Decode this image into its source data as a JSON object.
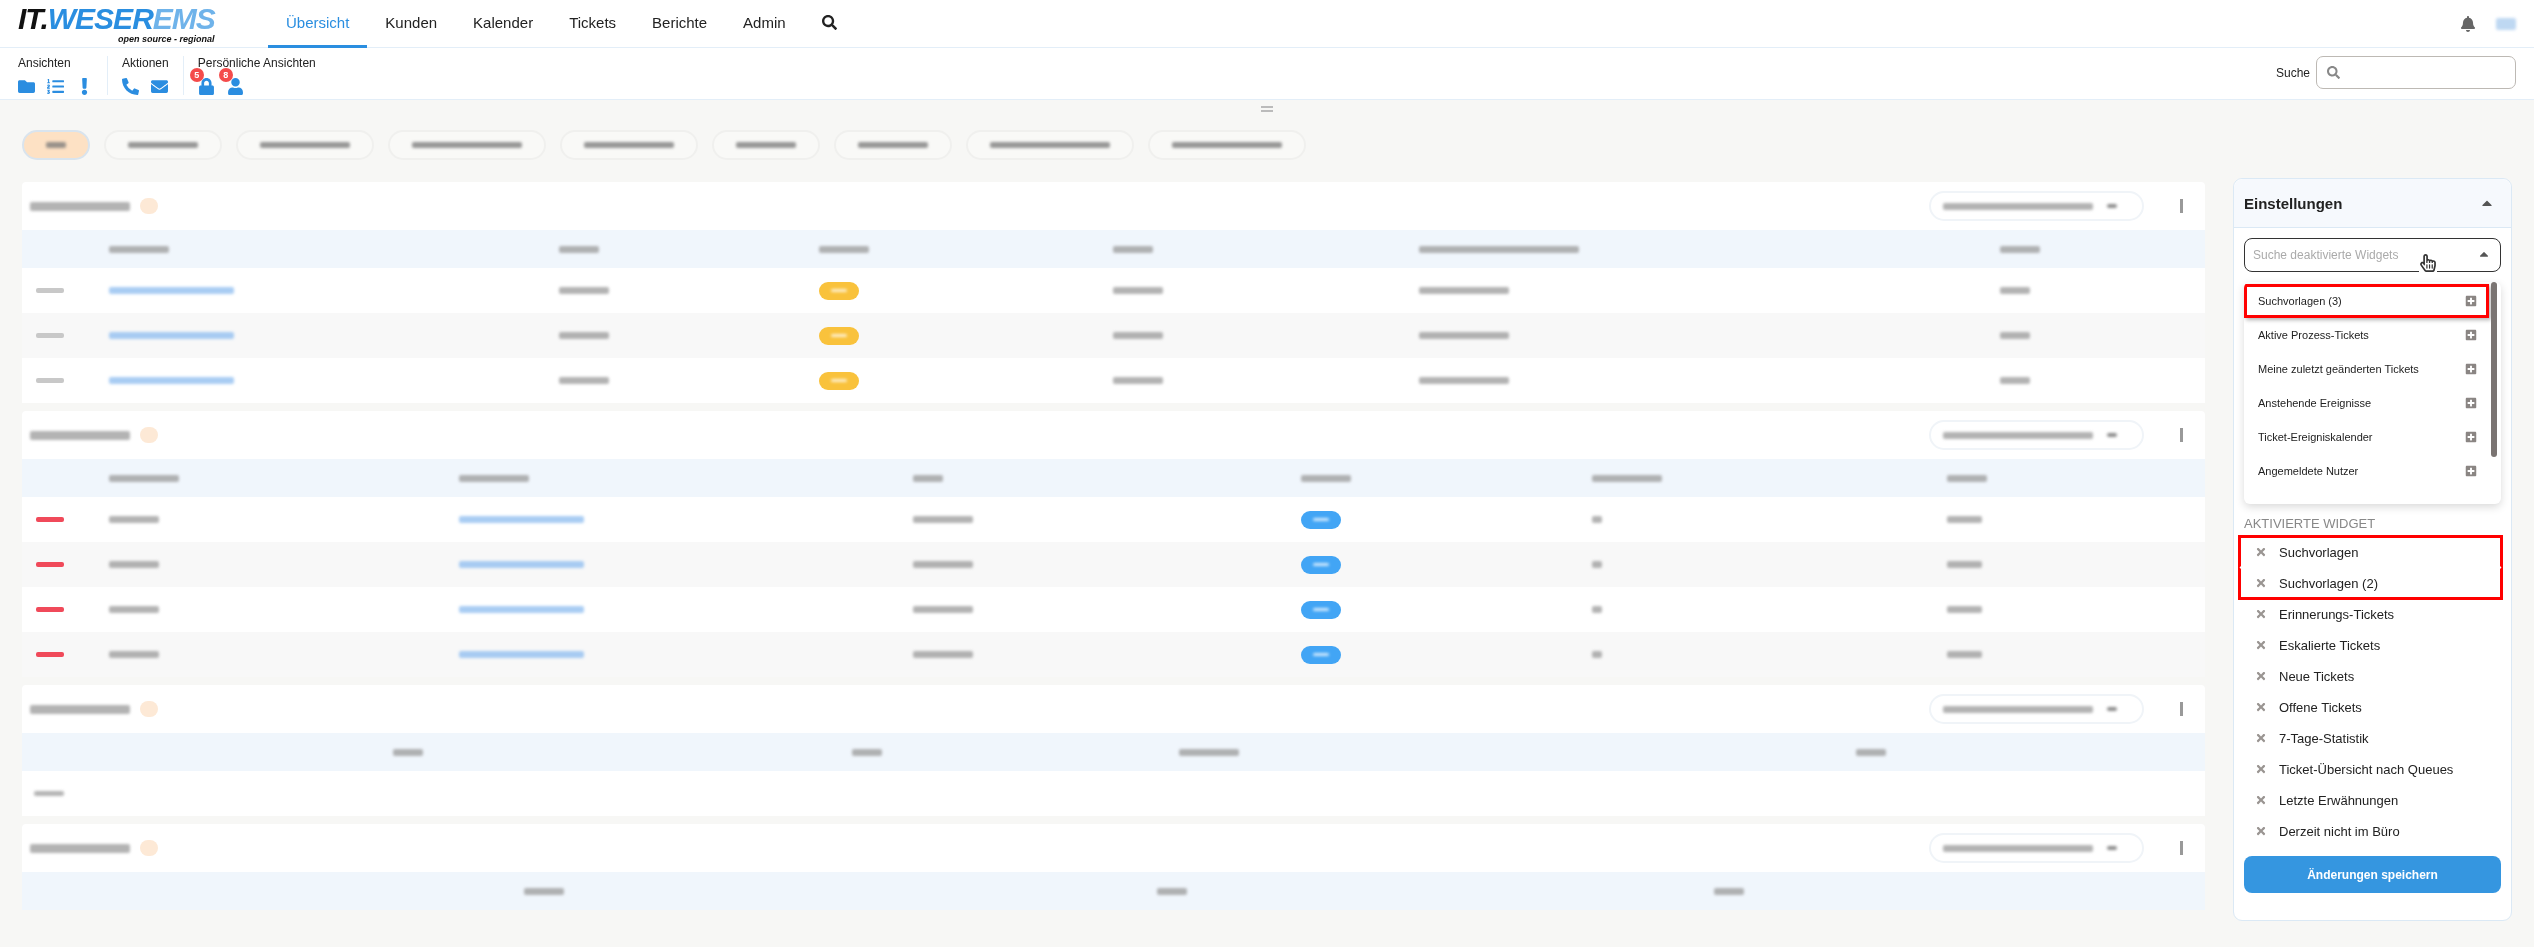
{
  "nav": {
    "items": [
      {
        "label": "Übersicht",
        "selected": true
      },
      {
        "label": "Kunden",
        "selected": false
      },
      {
        "label": "Kalender",
        "selected": false
      },
      {
        "label": "Tickets",
        "selected": false
      },
      {
        "label": "Berichte",
        "selected": false
      },
      {
        "label": "Admin",
        "selected": false
      }
    ]
  },
  "logo": {
    "brand": "IT.",
    "brand_accent": "WESER",
    "brand_tail": "EMS",
    "tagline": "open source - regional"
  },
  "toolbar": {
    "groups": [
      {
        "label": "Ansichten"
      },
      {
        "label": "Aktionen"
      },
      {
        "label": "Persönliche Ansichten",
        "badges": [
          "5",
          "8"
        ]
      }
    ],
    "search_label": "Suche"
  },
  "filter_chips": [
    {
      "selected": true
    },
    {
      "selected": false
    },
    {
      "selected": false
    },
    {
      "selected": false
    },
    {
      "selected": false
    },
    {
      "selected": false
    },
    {
      "selected": false
    },
    {
      "selected": false
    },
    {
      "selected": false
    }
  ],
  "widgets": [
    {
      "kind": "table",
      "rows": [
        {
          "flagged": false,
          "color": "#f9c23c"
        },
        {
          "flagged": false,
          "color": "#f9c23c"
        },
        {
          "flagged": false,
          "color": "#f9c23c"
        }
      ]
    },
    {
      "kind": "table",
      "rows": [
        {
          "flagged": true,
          "color": "#42a5f5"
        },
        {
          "flagged": true,
          "color": "#42a5f5"
        },
        {
          "flagged": true,
          "color": "#42a5f5"
        },
        {
          "flagged": true,
          "color": "#42a5f5"
        }
      ]
    },
    {
      "kind": "table",
      "empty_row": true
    },
    {
      "kind": "table"
    }
  ],
  "settings": {
    "title": "Einstellungen",
    "search_placeholder": "Suche deaktivierte Widgets",
    "deactivated": [
      {
        "label": "Suchvorlagen (3)",
        "highlighted": true
      },
      {
        "label": "Aktive Prozess-Tickets",
        "highlighted": false
      },
      {
        "label": "Meine zuletzt geänderten Tickets",
        "highlighted": false
      },
      {
        "label": "Anstehende Ereignisse",
        "highlighted": false
      },
      {
        "label": "Ticket-Ereigniskalender",
        "highlighted": false
      },
      {
        "label": "Angemeldete Nutzer",
        "highlighted": false
      }
    ],
    "active_heading": "AKTIVIERTE WIDGET",
    "active": [
      {
        "label": "Suchvorlagen",
        "highlighted": true
      },
      {
        "label": "Suchvorlagen (2)",
        "highlighted": true
      },
      {
        "label": "Erinnerungs-Tickets",
        "highlighted": false
      },
      {
        "label": "Eskalierte Tickets",
        "highlighted": false
      },
      {
        "label": "Neue Tickets",
        "highlighted": false
      },
      {
        "label": "Offene Tickets",
        "highlighted": false
      },
      {
        "label": "7-Tage-Statistik",
        "highlighted": false
      },
      {
        "label": "Ticket-Übersicht nach Queues",
        "highlighted": false
      },
      {
        "label": "Letzte Erwähnungen",
        "highlighted": false
      },
      {
        "label": "Derzeit nicht im Büro",
        "highlighted": false
      }
    ],
    "save_button": "Änderungen speichern"
  }
}
